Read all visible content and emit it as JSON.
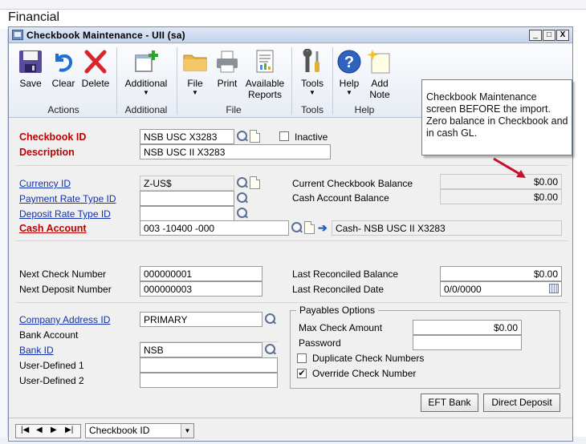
{
  "background": {
    "title": "Financial"
  },
  "window": {
    "title": "Checkbook Maintenance  -  UII (sa)",
    "controls": [
      "_",
      "□",
      "X"
    ]
  },
  "ribbon": {
    "buttons": {
      "save": "Save",
      "clear": "Clear",
      "delete": "Delete",
      "additional": "Additional",
      "file": "File",
      "print": "Print",
      "available_reports": "Available Reports",
      "tools": "Tools",
      "help": "Help",
      "add_note": "Add Note"
    },
    "groups": {
      "actions": "Actions",
      "additional": "Additional",
      "file": "File",
      "tools": "Tools",
      "help": "Help"
    }
  },
  "callout": "Checkbook Maintenance screen BEFORE the import. Zero balance in Checkbook and in cash GL.",
  "form": {
    "checkbook_id": {
      "label": "Checkbook ID",
      "value": "NSB USC X3283"
    },
    "inactive": {
      "label": "Inactive",
      "checked": false
    },
    "description": {
      "label": "Description",
      "value": "NSB USC II X3283"
    },
    "currency_id": {
      "label": "Currency ID",
      "value": "Z-US$"
    },
    "payment_rate_type_id": {
      "label": "Payment Rate Type ID",
      "value": ""
    },
    "deposit_rate_type_id": {
      "label": "Deposit Rate Type ID",
      "value": ""
    },
    "cash_account": {
      "label": "Cash Account",
      "value": "003 -10400 -000",
      "description": "Cash- NSB USC II X3283"
    },
    "current_checkbook_balance": {
      "label": "Current Checkbook Balance",
      "value": "$0.00"
    },
    "cash_account_balance": {
      "label": "Cash Account Balance",
      "value": "$0.00"
    },
    "next_check_number": {
      "label": "Next Check Number",
      "value": "000000001"
    },
    "next_deposit_number": {
      "label": "Next Deposit Number",
      "value": "000000003"
    },
    "last_reconciled_balance": {
      "label": "Last Reconciled Balance",
      "value": "$0.00"
    },
    "last_reconciled_date": {
      "label": "Last Reconciled Date",
      "value": "0/0/0000"
    },
    "company_address_id": {
      "label": "Company Address ID",
      "value": "PRIMARY"
    },
    "bank_account": {
      "label": "Bank Account",
      "value": ""
    },
    "bank_id": {
      "label": "Bank ID",
      "value": "NSB"
    },
    "user_defined_1": {
      "label": "User-Defined 1",
      "value": ""
    },
    "user_defined_2": {
      "label": "User-Defined 2",
      "value": ""
    }
  },
  "payables_options": {
    "title": "Payables Options",
    "max_check_amount": {
      "label": "Max Check Amount",
      "value": "$0.00"
    },
    "password": {
      "label": "Password",
      "value": ""
    },
    "duplicate_check_numbers": {
      "label": "Duplicate Check Numbers",
      "checked": false
    },
    "override_check_number": {
      "label": "Override Check Number",
      "checked": true
    }
  },
  "buttons": {
    "eft_bank": "EFT Bank",
    "direct_deposit": "Direct Deposit"
  },
  "statusbar": {
    "sort_by": "Checkbook ID"
  },
  "colors": {
    "required_label": "#c00000",
    "link_label": "#1030b0",
    "annotation_arrow": "#c8102e"
  }
}
